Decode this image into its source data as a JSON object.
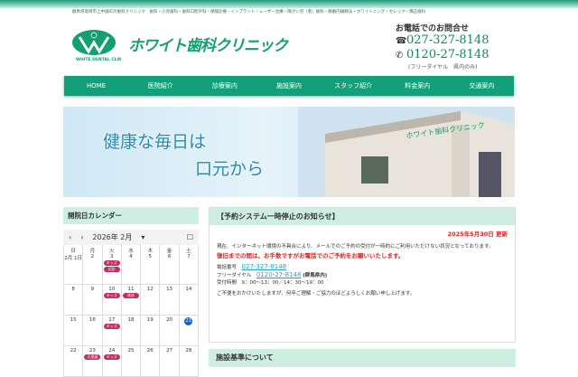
{
  "header": {
    "tagline": "群馬県高崎市上中居町の歯科クリニック　歯科・小児歯科・歯科口腔外科・保険診療・インプラント・レーザー治療・障がい児（者）歯科・静脈内鎮静法・ホワイトニング・セレック・矯正歯科",
    "logo_text": "ホワイト歯科クリニック",
    "logo_badge": "WHITE DENTAL CLINIC",
    "contact_heading": "お電話でのお問合せ",
    "tel": "027-327-8148",
    "freedial": "0120-27-8148",
    "freedial_note": "(フリーダイヤル　県内のみ)"
  },
  "nav": [
    "HOME",
    "医院紹介",
    "診療案内",
    "施設案内",
    "スタッフ紹介",
    "料金案内",
    "交通案内"
  ],
  "hero": {
    "line1": "健康な毎日は",
    "line2": "口元から"
  },
  "calendar": {
    "title": "開院日カレンダー",
    "month": "2026年 2月",
    "weekdays": [
      "日",
      "月",
      "火",
      "水",
      "木",
      "金",
      "土"
    ],
    "weeks": [
      [
        {
          "d": "2月 1日"
        },
        {
          "d": "2"
        },
        {
          "d": "3",
          "ev": [
            "キッズ",
            "初診"
          ]
        },
        {
          "d": "4"
        },
        {
          "d": "5"
        },
        {
          "d": "6"
        },
        {
          "d": "7"
        }
      ],
      [
        {
          "d": "8"
        },
        {
          "d": "9"
        },
        {
          "d": "10",
          "ev": [
            "キッズ"
          ]
        },
        {
          "d": "11",
          "ev": [
            "休診"
          ]
        },
        {
          "d": "12"
        },
        {
          "d": "13"
        },
        {
          "d": "14"
        }
      ],
      [
        {
          "d": "15"
        },
        {
          "d": "16"
        },
        {
          "d": "17",
          "ev": [
            "キッズ"
          ]
        },
        {
          "d": "18"
        },
        {
          "d": "19"
        },
        {
          "d": "20"
        },
        {
          "d": "21",
          "today": true
        }
      ],
      [
        {
          "d": "22"
        },
        {
          "d": "23",
          "ev": [
            "天皇誕"
          ]
        },
        {
          "d": "24",
          "ev": [
            "キッズ"
          ]
        },
        {
          "d": "25"
        },
        {
          "d": "26"
        },
        {
          "d": "27"
        },
        {
          "d": "28"
        }
      ]
    ]
  },
  "notice": {
    "title": "【予約システム一時停止のお知らせ】",
    "date": "2025年5月30日 更新",
    "body": "現在、インターネット環境の不具合により、メールでのご予約の受付が一時的にご利用いただけない状況となっております。",
    "red": "復旧までの間は、お手数ですがお電話でのご予約をお願いいたします。",
    "tel_label": "電話番号",
    "tel": "027-327-8148",
    "free_label": "フリーダイヤル",
    "free": "0120-27-8148",
    "free_note": "(群馬県内)",
    "hours_label": "受付時間",
    "hours": "9：00〜13：00／14：30〜19：00",
    "closing": "ご不便をおかけいたしますが、何卒ご理解・ご協力のほどよろしくお願い申し上げます。"
  },
  "notice2": {
    "title": "施設基準について"
  }
}
